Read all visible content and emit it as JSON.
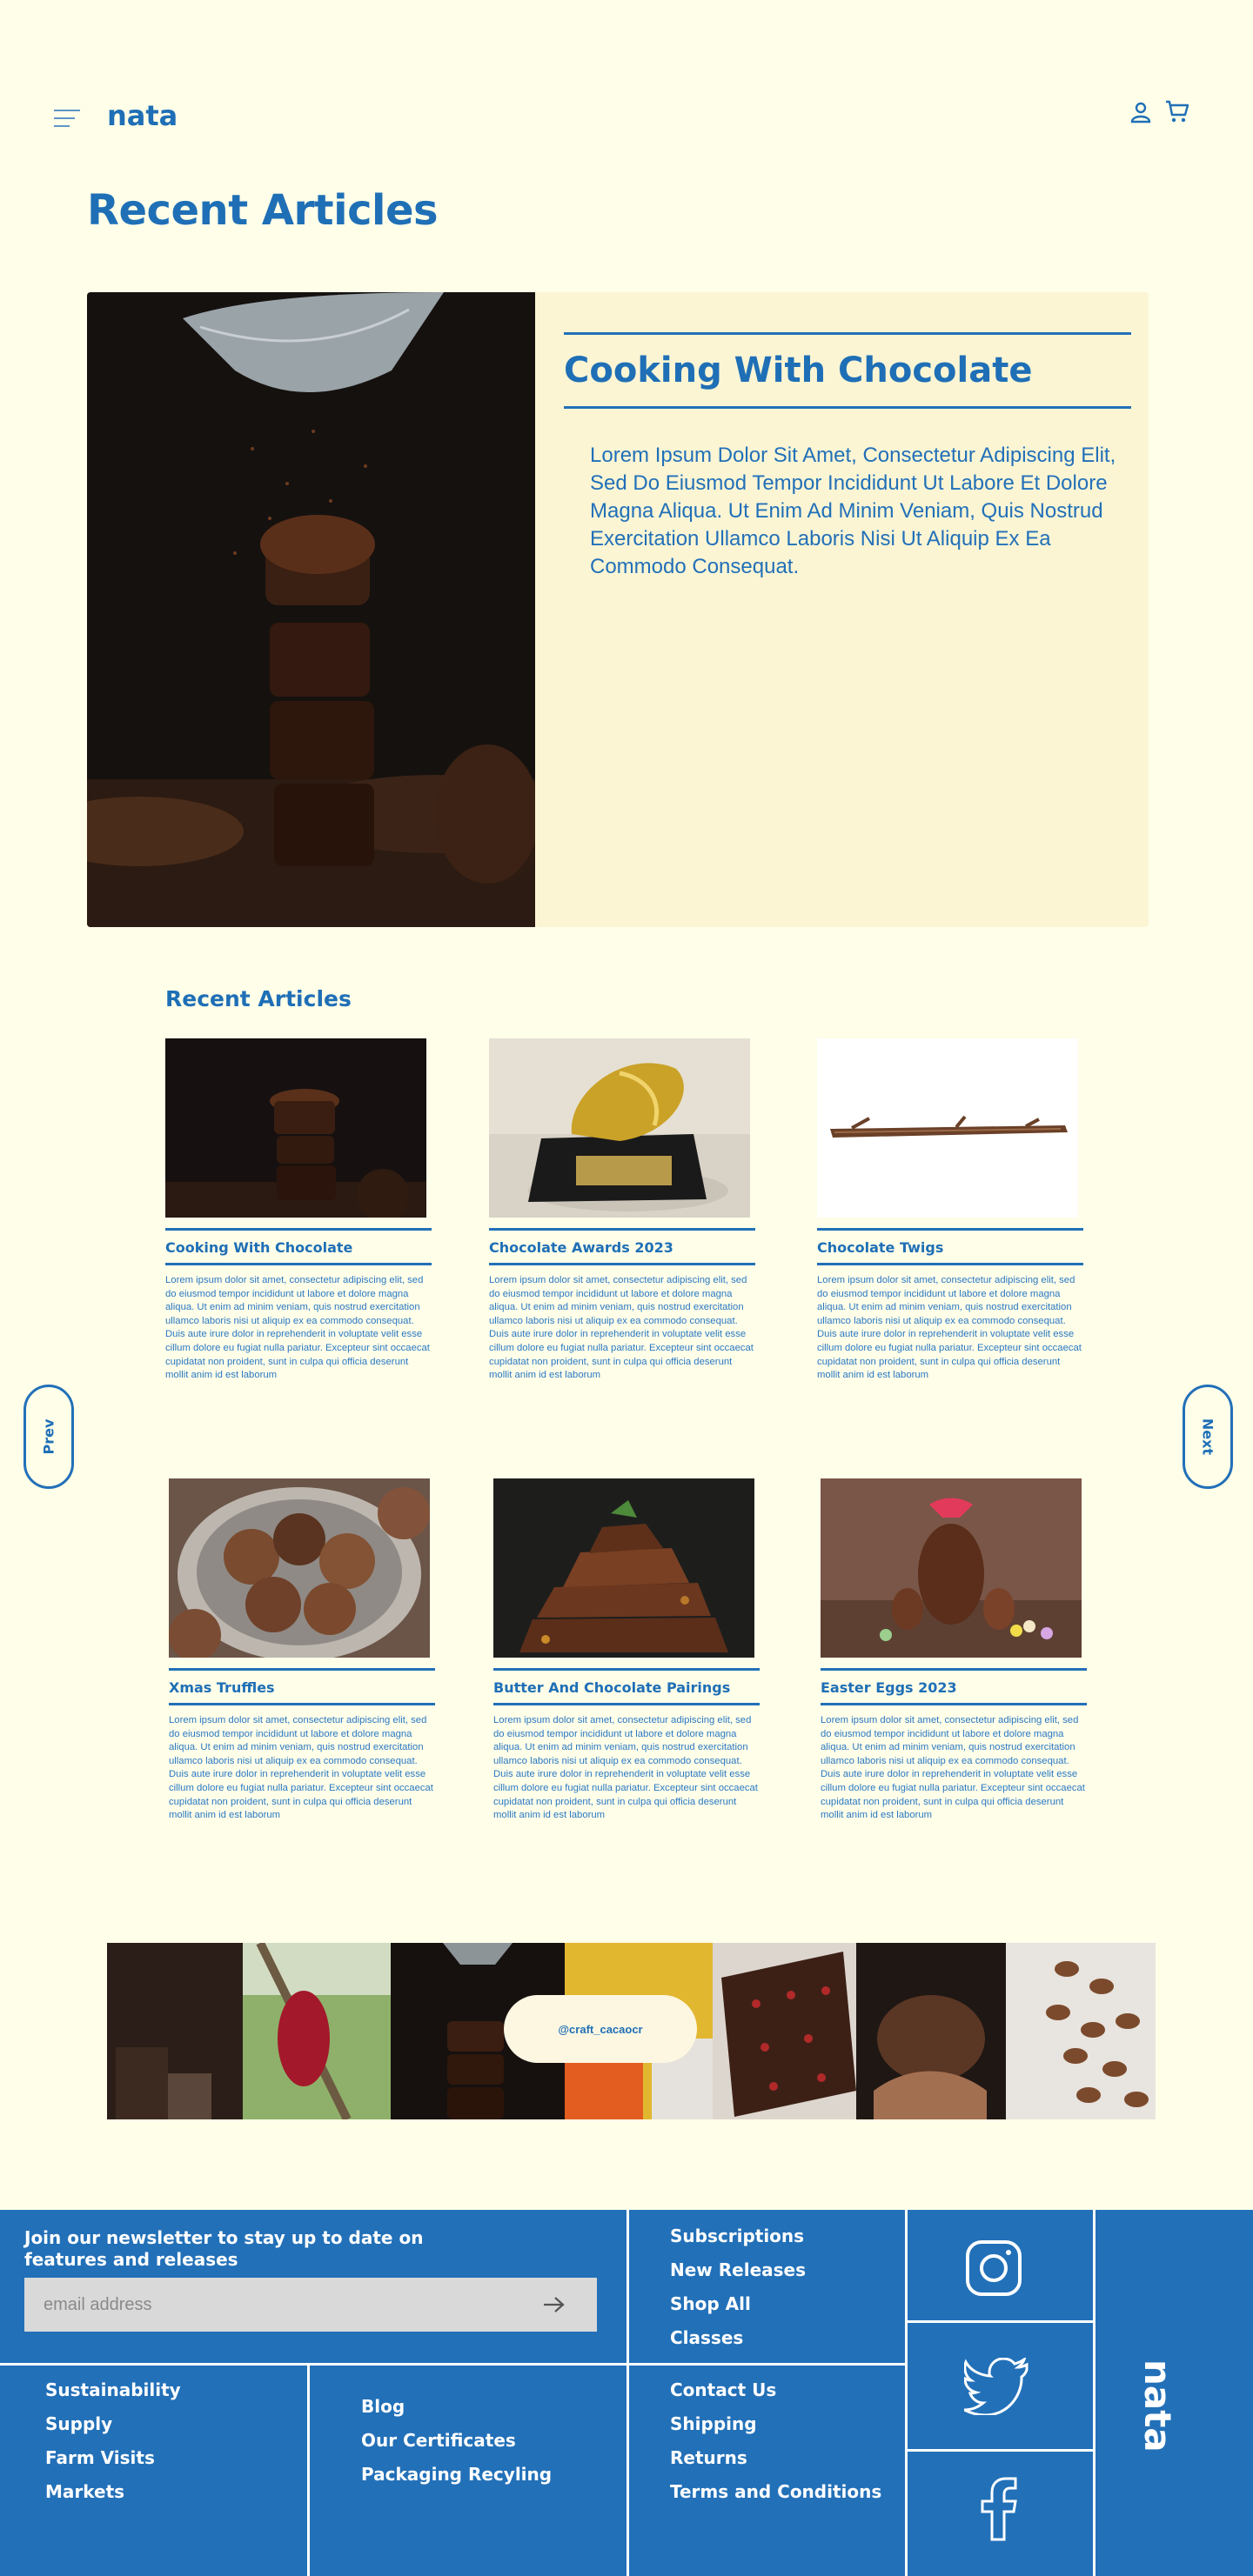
{
  "header": {
    "logo": "nata",
    "icons": [
      "menu-icon",
      "user-icon",
      "cart-icon"
    ]
  },
  "page_title": "Recent Articles",
  "hero": {
    "title": "Cooking With Chocolate",
    "body": "Lorem Ipsum Dolor Sit Amet, Consectetur Adipiscing Elit, Sed Do Eiusmod Tempor Incididunt Ut Labore Et Dolore Magna Aliqua. Ut Enim Ad Minim Veniam, Quis Nostrud Exercitation Ullamco Laboris Nisi Ut Aliquip Ex Ea Commodo Consequat."
  },
  "recent": {
    "title": "Recent Articles",
    "prev_label": "Prev",
    "next_label": "Next",
    "cards": [
      {
        "title": "Cooking With Chocolate",
        "text": "Lorem ipsum dolor sit amet, consectetur adipiscing elit, sed do eiusmod tempor incididunt ut labore et dolore magna aliqua. Ut enim ad minim veniam, quis nostrud exercitation ullamco laboris nisi ut aliquip ex ea commodo consequat. Duis aute irure dolor in reprehenderit in voluptate velit esse cillum dolore eu fugiat nulla pariatur. Excepteur sint occaecat cupidatat non proident, sunt in culpa qui officia deserunt mollit anim id est laborum"
      },
      {
        "title": "Chocolate Awards 2023",
        "text": "Lorem ipsum dolor sit amet, consectetur adipiscing elit, sed do eiusmod tempor incididunt ut labore et dolore magna aliqua. Ut enim ad minim veniam, quis nostrud exercitation ullamco laboris nisi ut aliquip ex ea commodo consequat. Duis aute irure dolor in reprehenderit in voluptate velit esse cillum dolore eu fugiat nulla pariatur. Excepteur sint occaecat cupidatat non proident, sunt in culpa qui officia deserunt mollit anim id est laborum"
      },
      {
        "title": "Chocolate Twigs",
        "text": "Lorem ipsum dolor sit amet, consectetur adipiscing elit, sed do eiusmod tempor incididunt ut labore et dolore magna aliqua. Ut enim ad minim veniam, quis nostrud exercitation ullamco laboris nisi ut aliquip ex ea commodo consequat. Duis aute irure dolor in reprehenderit in voluptate velit esse cillum dolore eu fugiat nulla pariatur. Excepteur sint occaecat cupidatat non proident, sunt in culpa qui officia deserunt mollit anim id est laborum"
      },
      {
        "title": "Xmas Truffles",
        "text": "Lorem ipsum dolor sit amet, consectetur adipiscing elit, sed do eiusmod tempor incididunt ut labore et dolore magna aliqua. Ut enim ad minim veniam, quis nostrud exercitation ullamco laboris nisi ut aliquip ex ea commodo consequat. Duis aute irure dolor in reprehenderit in voluptate velit esse cillum dolore eu fugiat nulla pariatur. Excepteur sint occaecat cupidatat non proident, sunt in culpa qui officia deserunt mollit anim id est laborum"
      },
      {
        "title": "Butter And Chocolate Pairings",
        "text": "Lorem ipsum dolor sit amet, consectetur adipiscing elit, sed do eiusmod tempor incididunt ut labore et dolore magna aliqua. Ut enim ad minim veniam, quis nostrud exercitation ullamco laboris nisi ut aliquip ex ea commodo consequat. Duis aute irure dolor in reprehenderit in voluptate velit esse cillum dolore eu fugiat nulla pariatur. Excepteur sint occaecat cupidatat non proident, sunt in culpa qui officia deserunt mollit anim id est laborum"
      },
      {
        "title": "Easter Eggs 2023",
        "text": "Lorem ipsum dolor sit amet, consectetur adipiscing elit, sed do eiusmod tempor incididunt ut labore et dolore magna aliqua. Ut enim ad minim veniam, quis nostrud exercitation ullamco laboris nisi ut aliquip ex ea commodo consequat. Duis aute irure dolor in reprehenderit in voluptate velit esse cillum dolore eu fugiat nulla pariatur. Excepteur sint occaecat cupidatat non proident, sunt in culpa qui officia deserunt mollit anim id est laborum"
      }
    ]
  },
  "instagram": {
    "handle": "@craft_cacaocr"
  },
  "footer": {
    "newsletter_heading": "Join our newsletter to stay up to date on features and releases",
    "email_placeholder": "email address",
    "links_top_right": [
      "Subscriptions",
      "New Releases",
      "Shop All",
      "Classes"
    ],
    "links_col1": [
      "Sustainability",
      "Supply",
      "Farm Visits",
      "Markets"
    ],
    "links_col2": [
      "Blog",
      "Our Certificates",
      "Packaging Recyling"
    ],
    "links_col3": [
      "Contact Us",
      "Shipping",
      "Returns",
      "Terms and Conditions"
    ],
    "social_icons": [
      "instagram-icon",
      "twitter-icon",
      "facebook-icon"
    ],
    "logo": "nata"
  },
  "colors": {
    "background": "#fefee9",
    "brand_blue": "#2270b8",
    "hero_panel": "#fbf5d4"
  }
}
